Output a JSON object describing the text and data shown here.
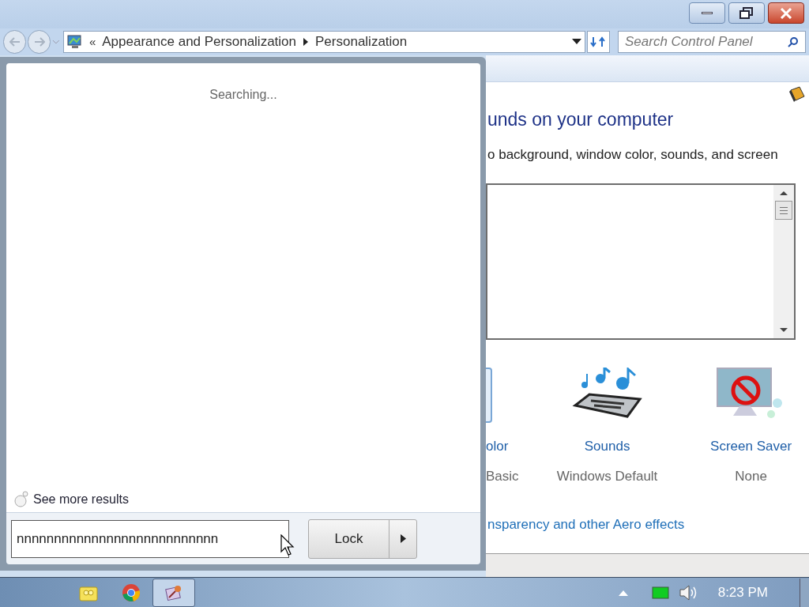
{
  "window": {
    "breadcrumbs": [
      "Appearance and Personalization",
      "Personalization"
    ],
    "overflow_mark": "«",
    "search": {
      "placeholder": "Search Control Panel"
    }
  },
  "content": {
    "heading": "unds on your computer",
    "description": "o background, window color, sounds, and screen",
    "items": [
      {
        "label": "olor",
        "value": "Basic",
        "kind": "partial"
      },
      {
        "label": "Sounds",
        "value": "Windows Default",
        "kind": "sounds"
      },
      {
        "label": "Screen Saver",
        "value": "None",
        "kind": "screensaver"
      }
    ],
    "link": "nsparency and other Aero effects"
  },
  "start_menu": {
    "status": "Searching...",
    "see_more": "See more results",
    "search": {
      "value": "nnnnnnnnnnnnnnnnnnnnnnnnnnn"
    },
    "power_button": "Lock"
  },
  "taskbar": {
    "apps": [
      {
        "kind": "folder",
        "selected": false
      },
      {
        "kind": "browser",
        "selected": false
      },
      {
        "kind": "paint",
        "selected": true
      }
    ],
    "clock": "8:23 PM"
  }
}
